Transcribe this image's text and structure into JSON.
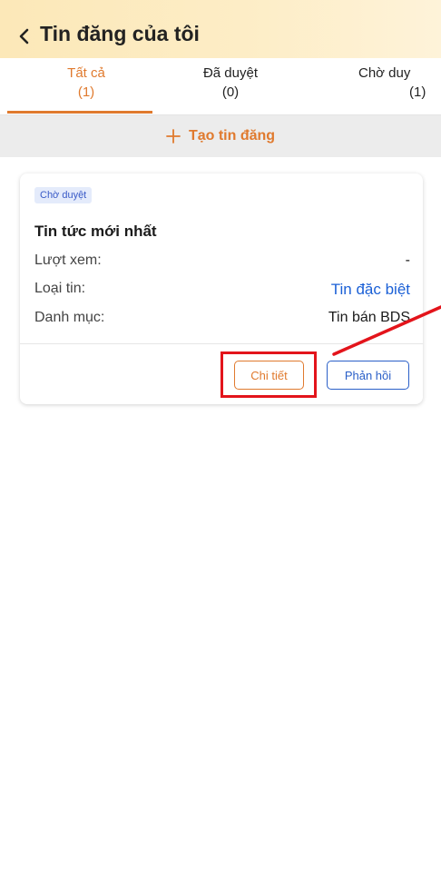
{
  "header": {
    "title": "Tin đăng của tôi",
    "back_icon": "chevron-left-icon"
  },
  "tabs": [
    {
      "label": "Tất cả",
      "count": "(1)",
      "active": true
    },
    {
      "label": "Đã duyệt",
      "count": "(0)",
      "active": false
    },
    {
      "label": "Chờ duy",
      "count": "(1)",
      "active": false
    }
  ],
  "create": {
    "label": "Tạo tin đăng",
    "icon": "plus-icon"
  },
  "listing": {
    "status_badge": "Chờ duyệt",
    "title": "Tin tức mới nhất",
    "rows": [
      {
        "key": "Lượt xem:",
        "value": "-"
      },
      {
        "key": "Loại tin:",
        "value": "Tin đặc biệt"
      },
      {
        "key": "Danh mục:",
        "value": "Tin bán BDS"
      }
    ],
    "detail_button": "Chi tiết",
    "reply_button": "Phản hồi"
  },
  "colors": {
    "accent": "#e07a2e",
    "link_blue": "#1b60d6",
    "annotation_red": "#e3141b",
    "header_gradient_start": "#fce8b8",
    "badge_bg": "#e4ebfb"
  }
}
